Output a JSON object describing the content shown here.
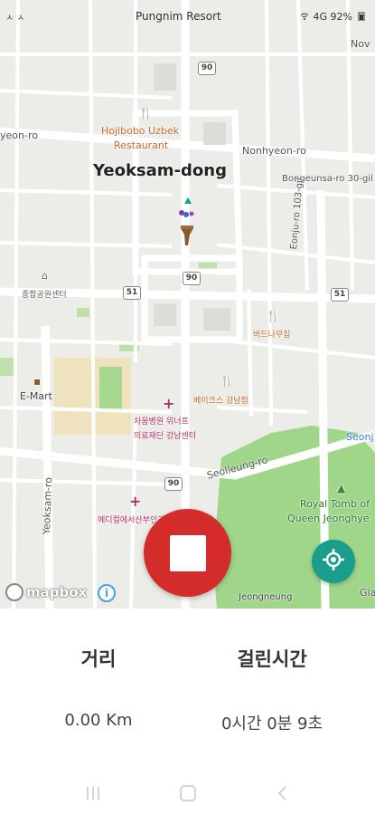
{
  "status_bar": {
    "left_text": "ㅅ ㅅ",
    "center_text": "Pungnim Resort",
    "right_text": "4G 92%"
  },
  "map": {
    "district_label": "Yeoksam-dong",
    "streets": {
      "nonhyeon_ro_left": "yeon-ro",
      "nonhyeon_ro_right": "Nonhyeon-ro",
      "bongeunsa_ro": "Bongeunsa-ro 30-gil",
      "eonju_ro": "Eonju-ro 103-gil",
      "yeoksam_ro": "Yeoksam-ro",
      "seolleung_ro": "Seolleung-ro",
      "nov": "Nov",
      "seon": "Seonj",
      "gia": "Gia"
    },
    "route_shields": [
      "90",
      "90",
      "51",
      "51",
      "90"
    ],
    "pois": {
      "restaurant_1_line1": "Hojibobo Uzbek",
      "restaurant_1_line2": "Restaurant",
      "emart": "E-Mart",
      "hospital_label_1": "차움병원 위너프",
      "hospital_label_2": "의료재단 강남센터",
      "cafe_1": "버드나무집",
      "cafe_2": "베이크스 강남점",
      "clinic": "메디컬에서산부인과",
      "center": "종합공원센터",
      "royal_tomb_1": "Royal Tomb of",
      "royal_tomb_2": "Queen Jeonghye",
      "jeongneung": "Jeongneung"
    },
    "attribution": "mapbox",
    "info_icon": "i"
  },
  "controls": {
    "stop_button": "stop-icon",
    "locate_button": "crosshair-icon"
  },
  "stats": {
    "distance_label": "거리",
    "distance_value": "0.00 Km",
    "time_label": "걸린시간",
    "time_value": "0시간 0분 9초"
  },
  "colors": {
    "stop": "#d42b2b",
    "locate": "#1a9e8c",
    "park": "#9fd68a"
  }
}
